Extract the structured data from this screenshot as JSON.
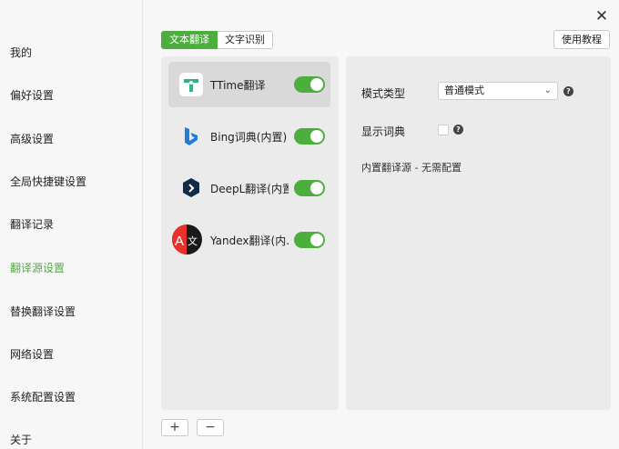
{
  "window": {
    "close_label": "✕"
  },
  "sidebar": {
    "items": [
      {
        "label": "我的"
      },
      {
        "label": "偏好设置"
      },
      {
        "label": "高级设置"
      },
      {
        "label": "全局快捷键设置"
      },
      {
        "label": "翻译记录"
      },
      {
        "label": "翻译源设置",
        "active": true
      },
      {
        "label": "替换翻译设置"
      },
      {
        "label": "网络设置"
      },
      {
        "label": "系统配置设置"
      },
      {
        "label": "关于"
      }
    ]
  },
  "tabs": [
    {
      "label": "文本翻译",
      "active": true
    },
    {
      "label": "文字识别"
    }
  ],
  "help_button": "使用教程",
  "sources": [
    {
      "name": "TTime翻译",
      "enabled": true,
      "selected": true,
      "icon": "ttime-icon"
    },
    {
      "name": "Bing词典(内置)",
      "enabled": true,
      "icon": "bing-icon"
    },
    {
      "name": "DeepL翻译(内置)",
      "enabled": true,
      "icon": "deepl-icon"
    },
    {
      "name": "Yandex翻译(内...",
      "enabled": true,
      "icon": "yandex-icon"
    }
  ],
  "settings": {
    "mode_label": "模式类型",
    "mode_value": "普通模式",
    "dict_label": "显示词典",
    "dict_checked": false,
    "note": "内置翻译源 - 无需配置",
    "help_mark": "?"
  },
  "bottom": {
    "add_label": "+",
    "remove_label": "−"
  },
  "colors": {
    "accent": "#4caf3d",
    "panel": "#ebebeb",
    "selected": "#d9d9d9"
  }
}
